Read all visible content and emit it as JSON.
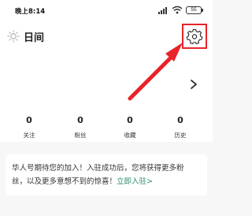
{
  "status_bar": {
    "time": "晚上8:14",
    "battery": "55",
    "icons": [
      "signal-icon",
      "wifi-icon",
      "battery-icon"
    ]
  },
  "header": {
    "theme_label": "日间",
    "theme_icon": "sun-icon",
    "settings_icon": "gear-icon",
    "profile_arrow_icon": "chevron-right-icon"
  },
  "stats": [
    {
      "value": "0",
      "label": "关注"
    },
    {
      "value": "0",
      "label": "粉丝"
    },
    {
      "value": "0",
      "label": "收藏"
    },
    {
      "value": "0",
      "label": "历史"
    }
  ],
  "promo": {
    "line1": "华人号期待您的加入！入驻成功后，您将获得更多粉",
    "line2_text": "丝，以及更多意想不到的惊喜！",
    "line2_link": "立即入驻>"
  },
  "annotation": {
    "color": "#e8232a"
  }
}
